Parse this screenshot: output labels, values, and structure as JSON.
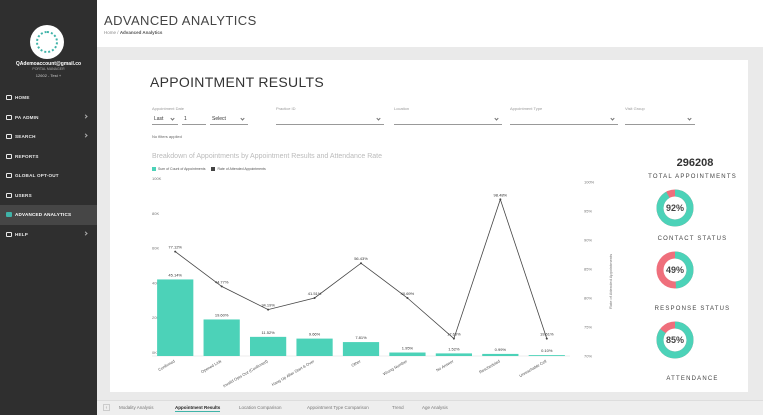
{
  "sidebar": {
    "user_email": "QAdemoaccount@gmail.co",
    "user_role": "PORTAL MANAGER",
    "user_org": "12602 - Test +",
    "items": [
      {
        "label": "HOME",
        "icon": "home-icon",
        "chevron": false,
        "active": false
      },
      {
        "label": "PA ADMIN",
        "icon": "admin-icon",
        "chevron": true,
        "active": false
      },
      {
        "label": "SEARCH",
        "icon": "search-icon",
        "chevron": true,
        "active": false
      },
      {
        "label": "REPORTS",
        "icon": "reports-icon",
        "chevron": false,
        "active": false
      },
      {
        "label": "GLOBAL OPT-OUT",
        "icon": "opt-out-icon",
        "chevron": false,
        "active": false
      },
      {
        "label": "USERS",
        "icon": "users-icon",
        "chevron": false,
        "active": false
      },
      {
        "label": "ADVANCED ANALYTICS",
        "icon": "analytics-icon",
        "chevron": false,
        "active": true
      },
      {
        "label": "HELP",
        "icon": "help-icon",
        "chevron": true,
        "active": false
      }
    ]
  },
  "header": {
    "title": "ADVANCED ANALYTICS",
    "breadcrumb_home": "Home",
    "breadcrumb_sep": "/",
    "breadcrumb_current": "Advanced Analytics"
  },
  "report": {
    "title": "APPOINTMENT RESULTS",
    "filters": {
      "appointment_date_label": "Appointment Date",
      "last_value": "Last",
      "count_value": "1",
      "select_value": "Select",
      "practice_label": "Practice ID",
      "location_label": "Location",
      "appointment_type_label": "Appointment Type",
      "visit_group_label": "Visit Group",
      "note": "No filters applied"
    },
    "chart_heading": "Breakdown of Appointments by Appointment Results and Attendance Rate",
    "legend": [
      {
        "label": "Sum of Count of Appointments",
        "color": "#4cd2b8"
      },
      {
        "label": "Rate of Attended Appointments",
        "color": "#444444"
      }
    ],
    "kpis": {
      "total_appointments_value": "296208",
      "total_appointments_title": "TOTAL APPOINTMENTS",
      "contact_status_title": "CONTACT STATUS",
      "response_status_title": "RESPONSE STATUS",
      "attendance_title": "ATTENDANCE",
      "donut1_value": "92%",
      "donut1_pct": 92,
      "donut2_value": "49%",
      "donut2_pct": 49,
      "donut3_value": "85%",
      "donut3_pct": 85,
      "donut_colors": {
        "primary": "#4cd2b8",
        "secondary": "#ef6f7c"
      }
    }
  },
  "chart_data": {
    "type": "bar",
    "categories": [
      "Confirmed",
      "Opened Link",
      "Invalid Opts Out (Confirmed)",
      "Hang Up After Start & Over",
      "Other",
      "Wrong Number",
      "No Answer",
      "Rescheduled",
      "Unreachable Cell"
    ],
    "series": [
      {
        "name": "Sum of Count of Appointments",
        "values": [
          44000,
          21000,
          11000,
          10000,
          8000,
          2000,
          1500,
          1200,
          500
        ],
        "labels": [
          "45.14%",
          "19.60%",
          "11.52%",
          "9.66%",
          "7.81%",
          "1.95%",
          "1.52%",
          "0.99%",
          "0.10%"
        ]
      },
      {
        "name": "Rate of Attended Appointments",
        "values": [
          88,
          82,
          78,
          80,
          86,
          80,
          73,
          97,
          73
        ],
        "labels": [
          "77.12%",
          "44.77%",
          "34.19%",
          "41.51%",
          "56.43%",
          "40.69%",
          "17.60%",
          "98.48%",
          "19.61%"
        ]
      }
    ],
    "y_left_ticks": [
      "100K",
      "80K",
      "60K",
      "40K",
      "20K",
      "0K"
    ],
    "y_right_ticks": [
      "100%",
      "95%",
      "90%",
      "85%",
      "80%",
      "75%",
      "70%"
    ],
    "y_right_label": "Rate of Attended Appointments"
  },
  "tabs": [
    "Modality Analysis",
    "Appointment Results",
    "Location Comparison",
    "Appointment Type Comparison",
    "Trend",
    "Age Analysis"
  ],
  "active_tab": 1
}
